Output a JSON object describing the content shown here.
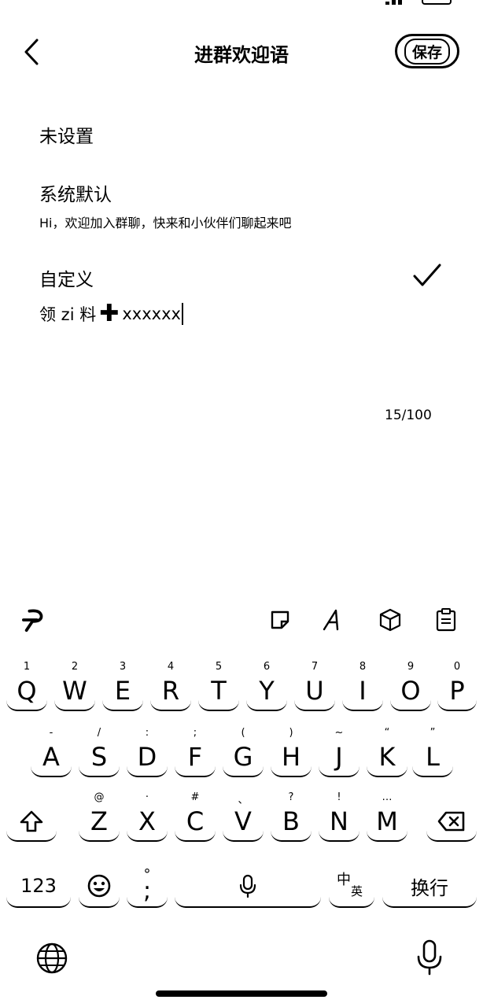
{
  "header": {
    "title": "进群欢迎语",
    "save_label": "保存"
  },
  "options": {
    "unset": {
      "label": "未设置"
    },
    "system_default": {
      "label": "系统默认",
      "description": "Hi，欢迎加入群聊，快来和小伙伴们聊起来吧"
    },
    "custom": {
      "label": "自定义",
      "selected": true
    }
  },
  "editor": {
    "text_part1": "领 zi 料",
    "text_plus": "✚",
    "text_part2": "xxxxxx",
    "char_count": "15/100"
  },
  "keyboard": {
    "row1": [
      {
        "letter": "Q",
        "hint": "1"
      },
      {
        "letter": "W",
        "hint": "2"
      },
      {
        "letter": "E",
        "hint": "3"
      },
      {
        "letter": "R",
        "hint": "4"
      },
      {
        "letter": "T",
        "hint": "5"
      },
      {
        "letter": "Y",
        "hint": "6"
      },
      {
        "letter": "U",
        "hint": "7"
      },
      {
        "letter": "I",
        "hint": "8"
      },
      {
        "letter": "O",
        "hint": "9"
      },
      {
        "letter": "P",
        "hint": "0"
      }
    ],
    "row2": [
      {
        "letter": "A",
        "hint": "-"
      },
      {
        "letter": "S",
        "hint": "/"
      },
      {
        "letter": "D",
        "hint": ":"
      },
      {
        "letter": "F",
        "hint": ";"
      },
      {
        "letter": "G",
        "hint": "("
      },
      {
        "letter": "H",
        "hint": ")"
      },
      {
        "letter": "J",
        "hint": "~"
      },
      {
        "letter": "K",
        "hint": "“"
      },
      {
        "letter": "L",
        "hint": "”"
      }
    ],
    "row3": [
      {
        "letter": "Z",
        "hint": "@"
      },
      {
        "letter": "X",
        "hint": "·"
      },
      {
        "letter": "C",
        "hint": "#"
      },
      {
        "letter": "V",
        "hint": "、"
      },
      {
        "letter": "B",
        "hint": "?"
      },
      {
        "letter": "N",
        "hint": "!"
      },
      {
        "letter": "M",
        "hint": "…"
      }
    ],
    "numbers_label": "123",
    "punct_top": "°",
    "punct_main": ";",
    "lang_top": "中",
    "lang_bottom": "英",
    "return_label": "换行"
  }
}
